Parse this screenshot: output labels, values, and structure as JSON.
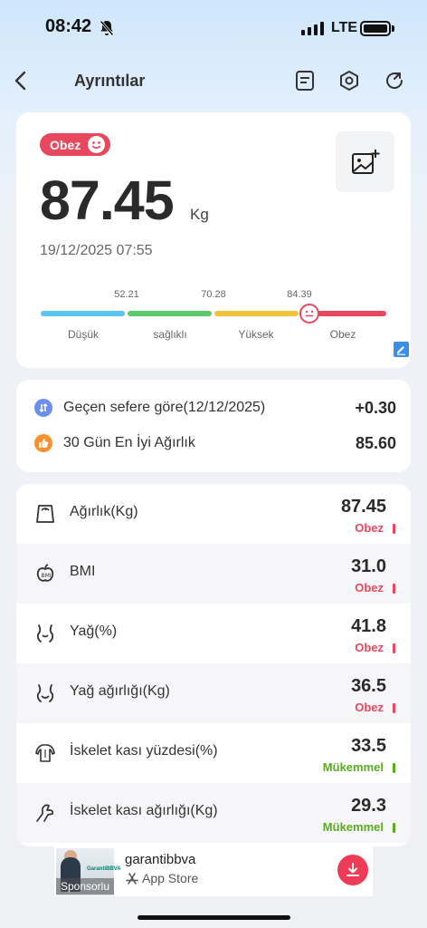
{
  "status_bar": {
    "time": "08:42",
    "network": "LTE"
  },
  "header": {
    "title": "Ayrıntılar"
  },
  "weight_card": {
    "badge": "Obez",
    "weight": "87.45",
    "unit": "Kg",
    "datetime": "19/12/2025 07:55",
    "scale": {
      "thresholds": [
        "52.21",
        "70.28",
        "84.39"
      ],
      "segments": [
        {
          "label": "Düşük",
          "color": "#5bc4f0"
        },
        {
          "label": "sağlıklı",
          "color": "#5cc86a"
        },
        {
          "label": "Yüksek",
          "color": "#f4c33e"
        },
        {
          "label": "Obez",
          "color": "#e8485e"
        }
      ]
    }
  },
  "comparison": [
    {
      "label": "Geçen sefere göre(12/12/2025)",
      "value": "+0.30",
      "icon": "compare-arrows-icon",
      "color": "#6b8ff0"
    },
    {
      "label": "30 Gün En İyi Ağırlık",
      "value": "85.60",
      "icon": "thumbs-up-icon",
      "color": "#f5922f"
    }
  ],
  "metrics": [
    {
      "label": "Ağırlık(Kg)",
      "value": "87.45",
      "status": "Obez",
      "status_color": "#e8485e",
      "icon": "scale-icon"
    },
    {
      "label": "BMI",
      "value": "31.0",
      "status": "Obez",
      "status_color": "#e8485e",
      "icon": "bmi-icon"
    },
    {
      "label": "Yağ(%)",
      "value": "41.8",
      "status": "Obez",
      "status_color": "#e8485e",
      "icon": "body-fat-icon"
    },
    {
      "label": "Yağ ağırlığı(Kg)",
      "value": "36.5",
      "status": "Obez",
      "status_color": "#e8485e",
      "icon": "fat-weight-icon"
    },
    {
      "label": "İskelet kası yüzdesi(%)",
      "value": "33.5",
      "status": "Mükemmel",
      "status_color": "#5aab1e",
      "icon": "muscle-icon"
    },
    {
      "label": "İskelet kası ağırlığı(Kg)",
      "value": "29.3",
      "status": "Mükemmel",
      "status_color": "#5aab1e",
      "icon": "muscle-weight-icon"
    }
  ],
  "ad": {
    "brand": "garantibbva",
    "store": "App Store",
    "sponsor": "Sponsorlu",
    "logo_text": "GarantiBBVA"
  },
  "colors": {
    "obese": "#e8485e",
    "excellent": "#5aab1e"
  }
}
